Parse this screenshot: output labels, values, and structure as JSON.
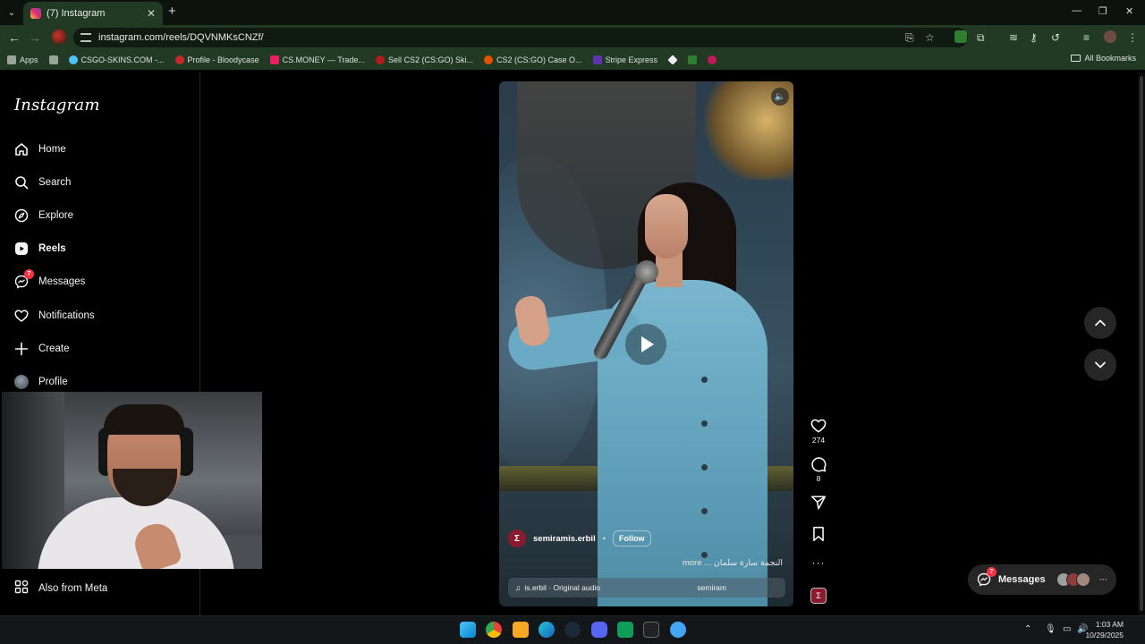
{
  "browser": {
    "tab_title": "(7) Instagram",
    "url": "instagram.com/reels/DQVNMKsCNZf/",
    "bookmarks": [
      {
        "label": "Apps",
        "color": "#9aa59a"
      },
      {
        "label": "",
        "color": "#9aa59a"
      },
      {
        "label": "CSGO-SKINS.COM -...",
        "color": "#4fc3f7"
      },
      {
        "label": "Profile - Bloodycase",
        "color": "#c62828"
      },
      {
        "label": "CS.MONEY — Trade...",
        "color": "#e91e63"
      },
      {
        "label": "Sell CS2 (CS:GO) Ski...",
        "color": "#b71c1c"
      },
      {
        "label": "CS2 (CS:GO) Case O...",
        "color": "#e65100"
      },
      {
        "label": "Stripe Express",
        "color": "#5e35b1"
      }
    ],
    "all_bookmarks": "All Bookmarks"
  },
  "sidebar": {
    "logo": "Instagram",
    "items": [
      {
        "label": "Home",
        "icon": "home-icon"
      },
      {
        "label": "Search",
        "icon": "search-icon"
      },
      {
        "label": "Explore",
        "icon": "compass-icon"
      },
      {
        "label": "Reels",
        "icon": "reels-icon"
      },
      {
        "label": "Messages",
        "icon": "messenger-icon",
        "badge": "7"
      },
      {
        "label": "Notifications",
        "icon": "heart-icon"
      },
      {
        "label": "Create",
        "icon": "plus-icon"
      },
      {
        "label": "Profile",
        "icon": "avatar"
      }
    ],
    "also_from_meta": "Also from Meta"
  },
  "reel": {
    "username": "semiramis.erbil",
    "separator": "•",
    "follow": "Follow",
    "caption": "النجمة سارة سلمان ... more",
    "audio": "is.erbil · Original audio",
    "audio_tag": "semiram",
    "likes": "274",
    "comments": "8"
  },
  "messages_pill": {
    "label": "Messages",
    "badge": "7",
    "more": "···"
  },
  "taskbar": {
    "time": "1:03 AM",
    "date": "10/29/2025"
  },
  "colors": {
    "accent_badge": "#ff3040",
    "chrome_green": "#223a24",
    "dress_blue": "#6aaac4"
  }
}
